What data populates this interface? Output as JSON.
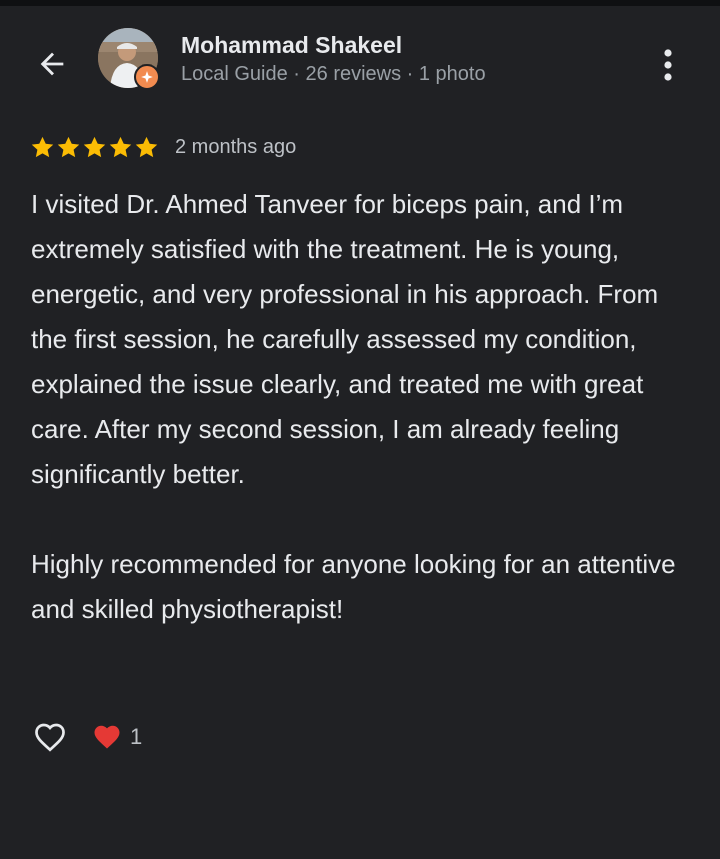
{
  "reviewer": {
    "name": "Mohammad Shakeel",
    "meta": "Local Guide · 26 reviews · 1 photo"
  },
  "icons": {
    "back": "arrow-left-icon",
    "more": "more-vert-icon",
    "badge": "local-guide-badge-icon",
    "star": "star-icon",
    "like": "heart-outline-icon",
    "reaction": "red-heart-icon"
  },
  "review": {
    "rating": 5,
    "time_ago": "2 months ago",
    "paragraph_1": "I visited Dr. Ahmed Tanveer for biceps pain, and I’m extremely satisfied with the treatment. He is young, energetic, and very professional in his approach. From the first session, he carefully assessed my condition, explained the issue clearly, and treated me with great care. After my second session, I am already feeling significantly better.",
    "paragraph_2": "Highly recommended for anyone looking for an attentive and skilled physiotherapist!"
  },
  "reactions": {
    "heart_count": "1"
  },
  "colors": {
    "background": "#202124",
    "star": "#fbbc04",
    "badge": "#f28b50",
    "heart": "#e53935"
  }
}
